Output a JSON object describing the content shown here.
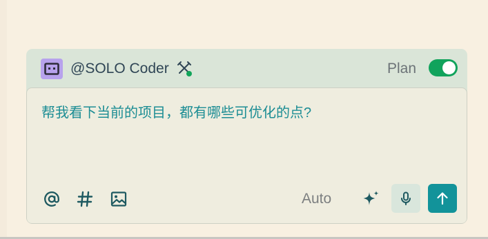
{
  "header": {
    "agent_name": "@SOLO Coder",
    "agent_avatar_icon": "terminal-icon",
    "tools_icon": "tools-icon",
    "status_color": "#12a55a",
    "plan_label": "Plan",
    "plan_toggle_on": true
  },
  "input": {
    "text": "帮我看下当前的项目，都有哪些可优化的点?"
  },
  "toolbar": {
    "mention_icon": "at-icon",
    "hash_icon": "hash-icon",
    "image_icon": "image-icon",
    "mode_value": "Auto",
    "enhance_icon": "sparkle-icon",
    "voice_icon": "microphone-icon",
    "send_icon": "arrow-up-icon"
  },
  "colors": {
    "accent": "#12939a",
    "toggle_on": "#11a35c",
    "avatar": "#b7a2ec",
    "page_background": "#f8f0e1"
  }
}
